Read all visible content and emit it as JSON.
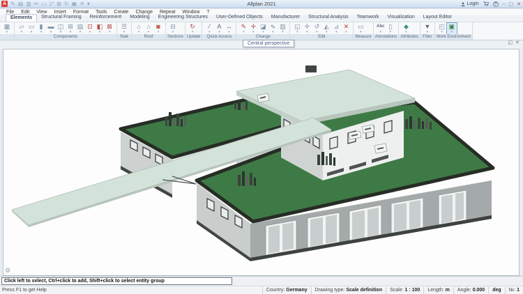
{
  "titlebar": {
    "title": "Allplan 2021",
    "logo": "A",
    "quick_icons": [
      {
        "name": "match-icon",
        "glyph": "✎"
      },
      {
        "name": "palette-icon",
        "glyph": "▤"
      },
      {
        "name": "save-icon",
        "glyph": "▥"
      },
      {
        "name": "edit-doc-icon",
        "glyph": "✏"
      },
      {
        "name": "comment-icon",
        "glyph": "▭"
      },
      {
        "name": "select-icon",
        "glyph": "◸"
      },
      {
        "name": "viewport-icon",
        "glyph": "⊞"
      },
      {
        "name": "refresh-icon",
        "glyph": "↻"
      },
      {
        "name": "window-icon",
        "glyph": "▣"
      },
      {
        "name": "close-doc-icon",
        "glyph": "✕"
      },
      {
        "name": "qat-caret-icon",
        "glyph": "▾"
      }
    ],
    "login_label": "Login",
    "help_glyph": "?",
    "window_controls": {
      "minimize": "–",
      "maximize": "▢",
      "close": "✕"
    }
  },
  "menubar": {
    "items": [
      "File",
      "Edit",
      "View",
      "Insert",
      "Format",
      "Tools",
      "Create",
      "Change",
      "Repeat",
      "Window",
      "?"
    ]
  },
  "ribbon": {
    "tabs": [
      {
        "label": "Elements",
        "active": true
      },
      {
        "label": "Structural Framing"
      },
      {
        "label": "Reinforcement"
      },
      {
        "label": "Modeling"
      },
      {
        "label": "Engineering Structures"
      },
      {
        "label": "User-Defined Objects"
      },
      {
        "label": "Manufacturer"
      },
      {
        "label": "Structural Analysis"
      },
      {
        "label": "Teamwork"
      },
      {
        "label": "Visualization"
      },
      {
        "label": "Layout Editor"
      }
    ],
    "groups": [
      {
        "label": "",
        "icons": [
          {
            "name": "viewport-cube-icon",
            "glyph": "▦",
            "color": "#7d91a8"
          }
        ]
      },
      {
        "label": "Components",
        "icons": [
          {
            "name": "wall-icon",
            "glyph": "▱",
            "color": "#7d91a8"
          },
          {
            "name": "slab-icon",
            "glyph": "▭",
            "color": "#7d91a8"
          },
          {
            "name": "column-icon",
            "glyph": "▮",
            "color": "#7d91a8"
          },
          {
            "name": "downstand-beam-icon",
            "glyph": "▬",
            "color": "#7d91a8"
          },
          {
            "name": "upstand-icon",
            "glyph": "◫",
            "color": "#7d91a8"
          },
          {
            "name": "window-opening-icon",
            "glyph": "⊞",
            "color": "#7d91a8"
          },
          {
            "name": "beam-grid-icon",
            "glyph": "▤",
            "color": "#7d91a8"
          },
          {
            "name": "smart-window-icon",
            "glyph": "⊡",
            "color": "#b5493f"
          },
          {
            "name": "smart-door-icon",
            "glyph": "◧",
            "color": "#b5493f"
          },
          {
            "name": "recess-icon",
            "glyph": "⊠",
            "color": "#b5493f"
          }
        ]
      },
      {
        "label": "Stair",
        "icons": [
          {
            "name": "stair-icon",
            "glyph": "☰",
            "color": "#7d91a8"
          }
        ]
      },
      {
        "label": "Roof",
        "icons": [
          {
            "name": "roof-frame-icon",
            "glyph": "⌂",
            "color": "#7d91a8"
          },
          {
            "name": "roof-covering-icon",
            "glyph": "⌂",
            "color": "#8fa08b"
          },
          {
            "name": "skylight-icon",
            "glyph": "◙",
            "color": "#b5493f"
          }
        ]
      },
      {
        "label": "Sections",
        "icons": [
          {
            "name": "section-icon",
            "glyph": "⊟",
            "color": "#7d91a8"
          }
        ]
      },
      {
        "label": "Update",
        "icons": [
          {
            "name": "update-3d-icon",
            "glyph": "↻",
            "color": "#b5493f"
          }
        ]
      },
      {
        "label": "Quick Access",
        "icons": [
          {
            "name": "line-icon",
            "glyph": "∕",
            "color": "#5a6a7d"
          },
          {
            "name": "text-icon",
            "glyph": "A",
            "color": "#5a6a7d"
          },
          {
            "name": "dimension-icon",
            "glyph": "↔",
            "color": "#5a6a7d"
          }
        ]
      },
      {
        "label": "Change",
        "icons": [
          {
            "name": "fillet-icon",
            "glyph": "✎",
            "color": "#b5493f"
          },
          {
            "name": "offset-icon",
            "glyph": "✛",
            "color": "#b5493f"
          },
          {
            "name": "edit-opening-icon",
            "glyph": "◪",
            "color": "#7d91a8"
          },
          {
            "name": "spline-icon",
            "glyph": "∿",
            "color": "#5a6a7d"
          },
          {
            "name": "match-properties-icon",
            "glyph": "▥",
            "color": "#7d91a8"
          }
        ]
      },
      {
        "label": "Edit",
        "icons": [
          {
            "name": "copy-icon",
            "glyph": "◱",
            "color": "#7d91a8"
          },
          {
            "name": "move-icon",
            "glyph": "✛",
            "color": "#7d91a8"
          },
          {
            "name": "rotate-icon",
            "glyph": "↺",
            "color": "#7d91a8"
          },
          {
            "name": "mirror-icon",
            "glyph": "◭",
            "color": "#7d91a8"
          },
          {
            "name": "scale-icon",
            "glyph": "⊿",
            "color": "#7d91a8"
          },
          {
            "name": "delete-icon",
            "glyph": "✕",
            "color": "#c23b32"
          }
        ]
      },
      {
        "label": "Measure",
        "icons": [
          {
            "name": "measure-icon",
            "glyph": "▭",
            "color": "#7d91a8"
          }
        ]
      },
      {
        "label": "Annotations",
        "icons": [
          {
            "name": "annotate-icon",
            "glyph": "Abc",
            "color": "#5a6a7d",
            "text": true
          },
          {
            "name": "label-icon",
            "glyph": "▯",
            "color": "#7d91a8"
          }
        ]
      },
      {
        "label": "Attributes",
        "icons": [
          {
            "name": "attributes-icon",
            "glyph": "◆",
            "color": "#3f8f8a"
          }
        ]
      },
      {
        "label": "Filter",
        "icons": [
          {
            "name": "filter-icon",
            "glyph": "▼",
            "color": "#5a6a7d"
          }
        ]
      },
      {
        "label": "Work Environment",
        "icons": [
          {
            "name": "plot-layout-icon",
            "glyph": "◰",
            "color": "#7d91a8"
          },
          {
            "name": "work-environment-icon",
            "glyph": "▣",
            "color": "#3f7d46",
            "selected": true
          }
        ]
      }
    ]
  },
  "viewport": {
    "tooltip": "Central perspective",
    "float_glyph": "◱",
    "close_glyph": "✕",
    "gear_glyph": "⚙"
  },
  "dialog_line": {
    "message": "Click left to select, Ctrl+click to add, Shift+click to select entity group"
  },
  "statusbar": {
    "help": "Press F1 to get Help",
    "cells": [
      {
        "label": "Country:",
        "value": "Germany"
      },
      {
        "label": "Drawing type:",
        "value": "Scale definition"
      },
      {
        "label": "Scale:",
        "value": "1 : 100"
      },
      {
        "label": "Length:",
        "value": "m"
      },
      {
        "label": "Angle:",
        "value": "0.000"
      },
      {
        "label": "",
        "value": "deg"
      },
      {
        "label": "№:",
        "value": "1"
      }
    ]
  },
  "colors": {
    "logo_red": "#dd3b2f",
    "roof_green": "#3e7a46",
    "parapet_dark": "#272d25",
    "canopy_green": "#d4e3da",
    "wall_light": "#cdd1d0",
    "wall_bright": "#eef0ef",
    "wall_dark": "#a4aaa9",
    "plinth_dark": "#424745",
    "viewport_bg": "#fdfdfd"
  }
}
